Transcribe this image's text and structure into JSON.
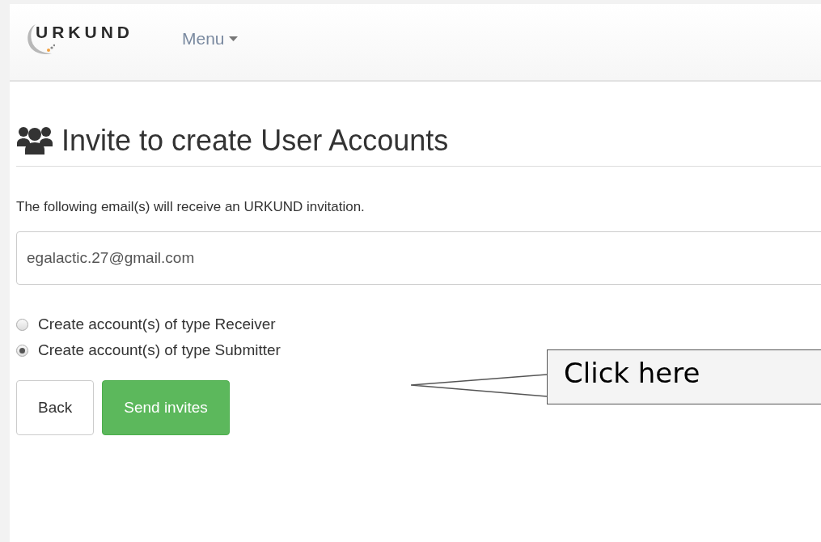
{
  "navbar": {
    "logo": "URKUND",
    "menu": "Menu"
  },
  "heading": "Invite to create User Accounts",
  "intro": "The following email(s) will receive an URKUND invitation.",
  "email_field": {
    "value": "egalactic.27@gmail.com"
  },
  "account_types": [
    {
      "label": "Create account(s) of type Receiver",
      "selected": false
    },
    {
      "label": "Create account(s) of type Submitter",
      "selected": true
    }
  ],
  "buttons": [
    {
      "label": "Back",
      "kind": "default"
    },
    {
      "label": "Send invites",
      "kind": "primary"
    }
  ],
  "callout": {
    "text": "Click here"
  }
}
